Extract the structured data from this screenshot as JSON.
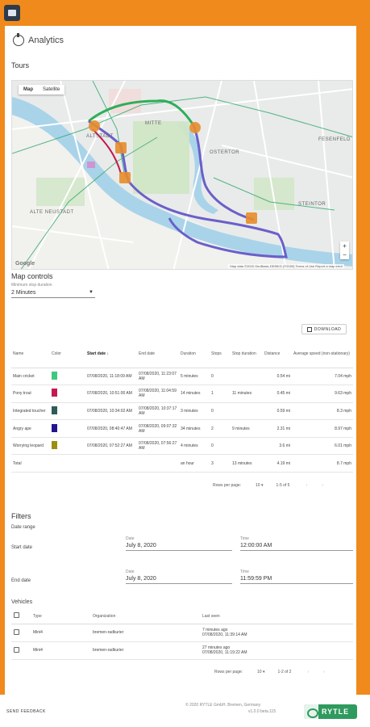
{
  "header": {
    "app_icon": "app-window-icon"
  },
  "page": {
    "title": "Analytics",
    "title_icon": "analytics-icon"
  },
  "tours_section": {
    "title": "Tours"
  },
  "map": {
    "tabs": [
      "Map",
      "Satellite"
    ],
    "zoom_in": "+",
    "zoom_out": "−",
    "google": "Google",
    "credit": "Map data ©2020 GeoBasis-DE/BKG (©2009)   Terms of Use   Report a map error",
    "labels": [
      "ALTSTADT",
      "MITTE",
      "OSTERTOR",
      "ALTE NEUSTADT",
      "STEINTOR",
      "FESENFELD"
    ],
    "colors": {
      "route_purple": "#6b5fc9",
      "route_green": "#2fae5a",
      "marker": "#e88d2b",
      "water": "#a9d3e9",
      "park": "#cfe6c4"
    }
  },
  "map_controls": {
    "title": "Map controls",
    "select_label": "Minimum stop duration",
    "select_value": "2 Minutes"
  },
  "download_label": "DOWNLOAD",
  "tours_table": {
    "headers": [
      "Name",
      "Color",
      "Start date",
      "End date",
      "Duration",
      "Stops",
      "Stop duration",
      "Distance",
      "Average speed (non-stationary)"
    ],
    "rows": [
      {
        "name": "Main cricket",
        "color": "#3ec97e",
        "start": "07/08/2020, 11:18:09 AM",
        "end": "07/08/2020, 11:23:07 AM",
        "duration": "5 minutes",
        "stops": "0",
        "stop_duration": "",
        "distance": "0.54 mi",
        "speed": "7.04 mph"
      },
      {
        "name": "Pony trout",
        "color": "#c21a4f",
        "start": "07/08/2020, 10:51:00 AM",
        "end": "07/08/2020, 11:04:59 AM",
        "duration": "14 minutes",
        "stops": "1",
        "stop_duration": "11 minutes",
        "distance": "0.45 mi",
        "speed": "9.63 mph"
      },
      {
        "name": "Integrated toucher",
        "color": "#2e5c58",
        "start": "07/08/2020, 10:34:02 AM",
        "end": "07/08/2020, 10:37:17 AM",
        "duration": "3 minutes",
        "stops": "0",
        "stop_duration": "",
        "distance": "0.59 mi",
        "speed": "8.3 mph"
      },
      {
        "name": "Angry ape",
        "color": "#24158f",
        "start": "07/08/2020, 08:40:47 AM",
        "end": "07/08/2020, 09:07:32 AM",
        "duration": "34 minutes",
        "stops": "2",
        "stop_duration": "9 minutes",
        "distance": "2.31 mi",
        "speed": "8.97 mph"
      },
      {
        "name": "Worrying leopard",
        "color": "#9a8f12",
        "start": "07/08/2020, 07:52:27 AM",
        "end": "07/08/2020, 07:56:27 AM",
        "duration": "4 minutes",
        "stops": "0",
        "stop_duration": "",
        "distance": "3.6 mi",
        "speed": "6.01 mph"
      }
    ],
    "total": {
      "label": "Total",
      "duration": "an hour",
      "stops": "3",
      "stop_duration": "13 minutes",
      "distance": "4.19 mi",
      "speed": "8.7 mph"
    },
    "pagination": {
      "rows_label": "Rows per page:",
      "rows_value": "10",
      "range": "1-5 of 5"
    }
  },
  "filters": {
    "title": "Filters",
    "date_range": "Date range",
    "start_label": "Start date",
    "end_label": "End date",
    "date_field_label": "Date",
    "time_field_label": "Time",
    "start_date": "July 8, 2020",
    "start_time": "12:00:00 AM",
    "end_date": "July 8, 2020",
    "end_time": "11:59:59 PM"
  },
  "vehicles": {
    "title": "Vehicles",
    "headers": [
      "Type",
      "Organization",
      "Last seen"
    ],
    "rows": [
      {
        "type": "Mini4",
        "org": "bremen-radkurier",
        "last_seen_rel": "7 minutes ago",
        "last_seen_abs": "07/08/2020, 11:39:14 AM"
      },
      {
        "type": "Mini4",
        "org": "bremen-radkurier",
        "last_seen_rel": "27 minutes ago",
        "last_seen_abs": "07/08/2020, 11:19:22 AM"
      }
    ],
    "pagination": {
      "rows_label": "Rows per page:",
      "rows_value": "10",
      "range": "1-2 of 2"
    }
  },
  "footer": {
    "feedback": "SEND FEEDBACK",
    "copyright": "© 2020 RYTLE GmbH, Bremen, Germany",
    "version": "v1.0.0 beta.115",
    "logo_text": "RYTLE"
  }
}
